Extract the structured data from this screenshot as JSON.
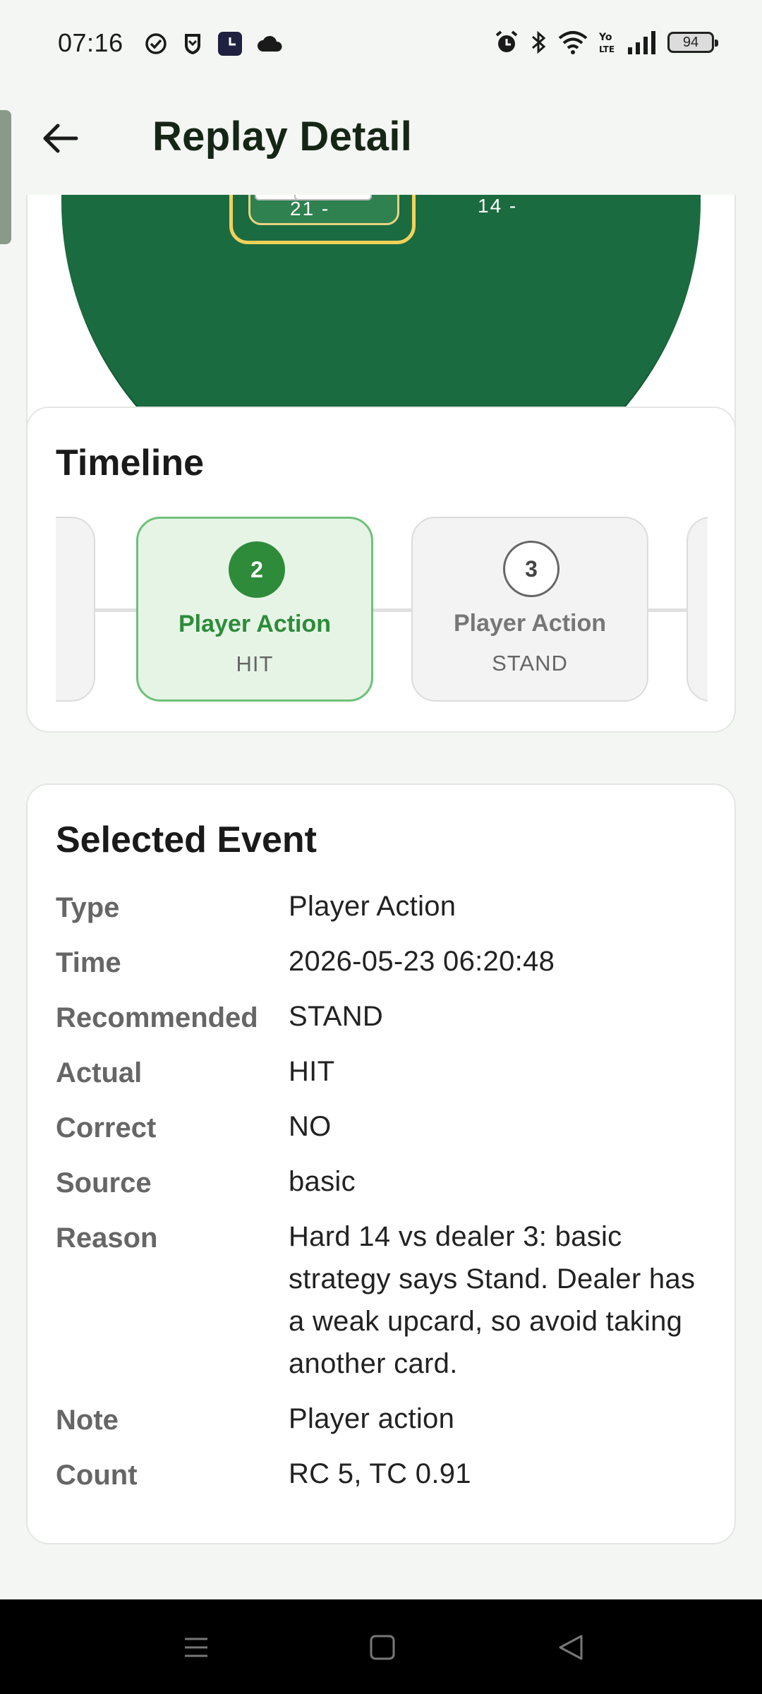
{
  "status_bar": {
    "time": "07:16",
    "left_icons": [
      "check-circle-icon",
      "shield-icon",
      "clock-app-icon",
      "cloud-icon"
    ],
    "right_icons": [
      "alarm-icon",
      "bluetooth-icon",
      "wifi-icon",
      "volte-icon",
      "signal-icon"
    ],
    "battery": "94"
  },
  "app_bar": {
    "title": "Replay Detail",
    "back_icon": "arrow-left-icon"
  },
  "table": {
    "player_total": "21  -",
    "dealer_total": "14  -",
    "felt_color": "#1b6b40",
    "highlight_color": "#f2d15b"
  },
  "timeline": {
    "title": "Timeline",
    "steps": [
      {
        "number": "2",
        "label": "Player Action",
        "sub": "HIT",
        "active": true
      },
      {
        "number": "3",
        "label": "Player Action",
        "sub": "STAND",
        "active": false
      }
    ],
    "accent_color": "#2e8b3a"
  },
  "selected_event": {
    "title": "Selected Event",
    "rows": [
      {
        "key": "Type",
        "value": "Player Action"
      },
      {
        "key": "Time",
        "value": "2026-05-23 06:20:48"
      },
      {
        "key": "Recommended",
        "value": "STAND"
      },
      {
        "key": "Actual",
        "value": "HIT"
      },
      {
        "key": "Correct",
        "value": "NO"
      },
      {
        "key": "Source",
        "value": "basic"
      },
      {
        "key": "Reason",
        "value": "Hard 14 vs dealer 3: basic strategy says Stand. Dealer has a weak upcard, so avoid taking another card."
      },
      {
        "key": "Note",
        "value": "Player action"
      },
      {
        "key": "Count",
        "value": "RC 5, TC 0.91"
      }
    ]
  },
  "nav_bar": {
    "buttons": [
      "menu-icon",
      "home-icon",
      "back-triangle-icon"
    ]
  }
}
